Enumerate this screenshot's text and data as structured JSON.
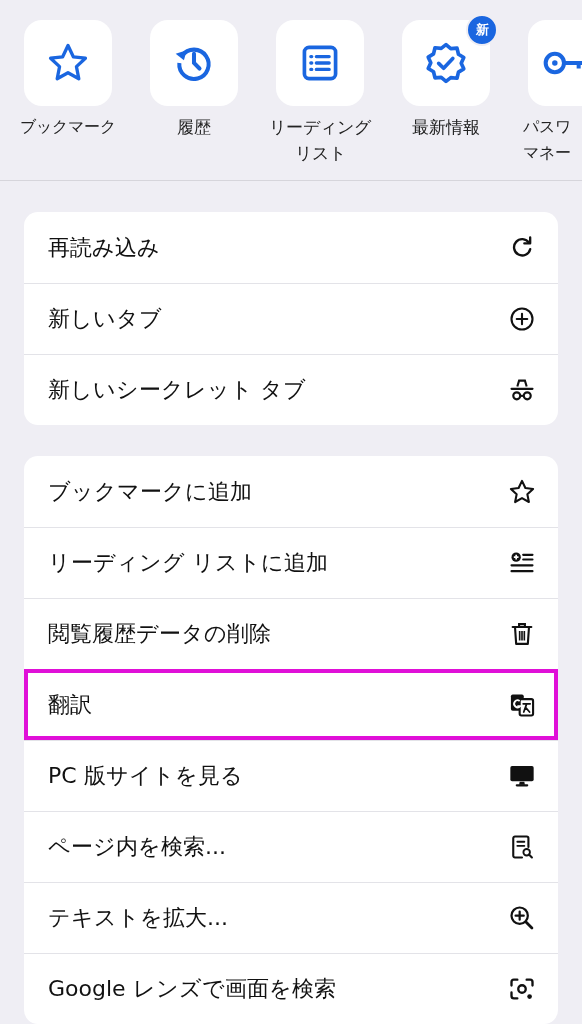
{
  "shortcuts": [
    {
      "label": "ブックマーク"
    },
    {
      "label": "履歴"
    },
    {
      "label": "リーディングリスト"
    },
    {
      "label": "最新情報",
      "badge": "新"
    },
    {
      "label": "パスワマネー"
    }
  ],
  "menu_groups": [
    [
      {
        "label": "再読み込み",
        "highlighted": false
      },
      {
        "label": "新しいタブ",
        "highlighted": false
      },
      {
        "label": "新しいシークレット タブ",
        "highlighted": false
      }
    ],
    [
      {
        "label": "ブックマークに追加",
        "highlighted": false
      },
      {
        "label": "リーディング リストに追加",
        "highlighted": false
      },
      {
        "label": "閲覧履歴データの削除",
        "highlighted": false
      },
      {
        "label": "翻訳",
        "highlighted": true
      },
      {
        "label": "PC 版サイトを見る",
        "highlighted": false
      },
      {
        "label": "ページ内を検索...",
        "highlighted": false
      },
      {
        "label": "テキストを拡大...",
        "highlighted": false
      },
      {
        "label": "Google レンズで画面を検索",
        "highlighted": false
      }
    ]
  ]
}
